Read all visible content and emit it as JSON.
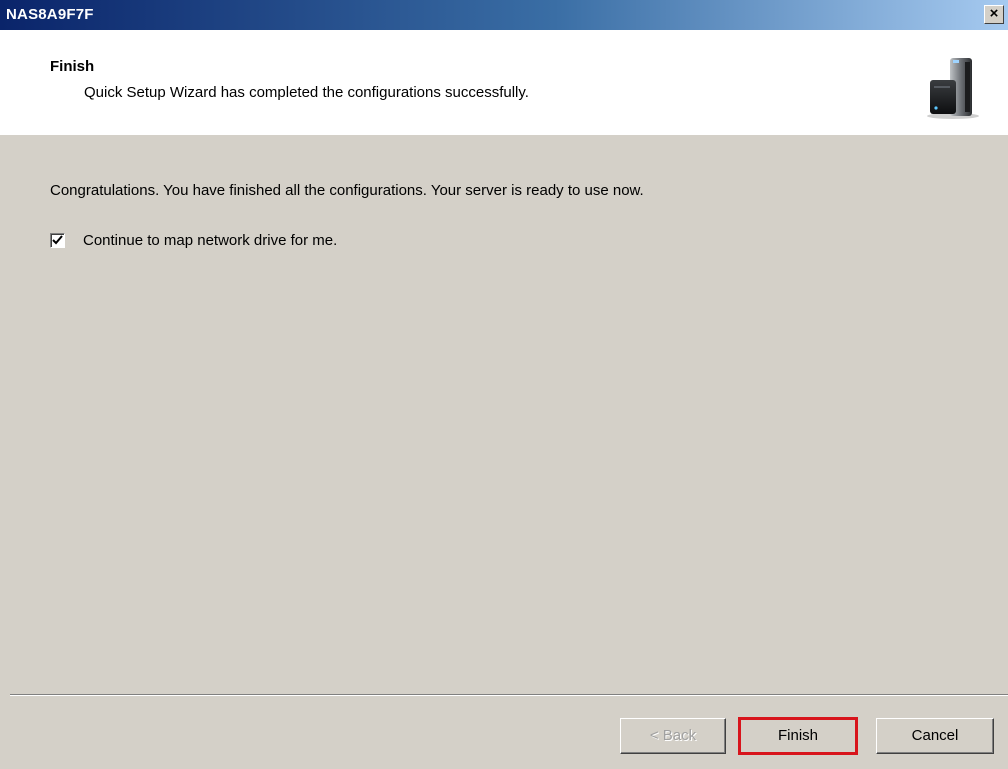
{
  "window": {
    "title": "NAS8A9F7F",
    "close_glyph": "×"
  },
  "header": {
    "title": "Finish",
    "subtitle": "Quick Setup Wizard has completed the configurations successfully.",
    "icon": "nas-device-icon"
  },
  "body": {
    "message": "Congratulations. You have finished all the configurations. Your server is ready to use now.",
    "checkbox": {
      "label": "Continue to map network drive for me.",
      "checked": true
    }
  },
  "buttons": {
    "back_label": "< Back",
    "finish_label": "Finish",
    "cancel_label": "Cancel"
  },
  "colors": {
    "titlebar_start": "#0a246a",
    "titlebar_end": "#a6caf0",
    "dialog_bg": "#d4d0c8",
    "highlight_outline": "#d8141c"
  }
}
